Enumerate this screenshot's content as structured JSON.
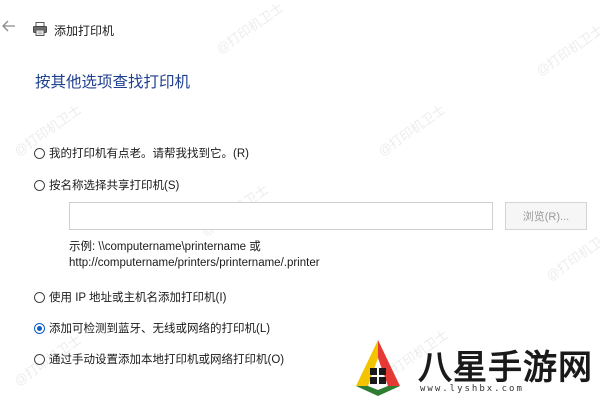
{
  "window": {
    "title": "添加打印机",
    "back_icon": "arrow-left-icon",
    "printer_icon": "printer-icon"
  },
  "heading": "按其他选项查找打印机",
  "options": {
    "old_printer": {
      "label": "我的打印机有点老。请帮我找到它。(R)",
      "checked": false
    },
    "shared_by_name": {
      "label": "按名称选择共享打印机(S)",
      "checked": false
    },
    "ip_hostname": {
      "label": "使用 IP 地址或主机名添加打印机(I)",
      "checked": false
    },
    "bluetooth_wireless": {
      "label": "添加可检测到蓝牙、无线或网络的打印机(L)",
      "checked": true
    },
    "manual_local": {
      "label": "通过手动设置添加本地打印机或网络打印机(O)",
      "checked": false
    }
  },
  "share_name": {
    "value": "",
    "browse_label": "浏览(R)..."
  },
  "example": {
    "line1": "示例: \\\\computername\\printername 或",
    "line2": "http://computername/printers/printername/.printer"
  },
  "watermark": "@打印机卫士",
  "site_logo": {
    "name": "八星手游网",
    "url": "www.lyshbx.com"
  },
  "colors": {
    "heading": "#1f3f8f",
    "accent": "#0f5fc5"
  }
}
